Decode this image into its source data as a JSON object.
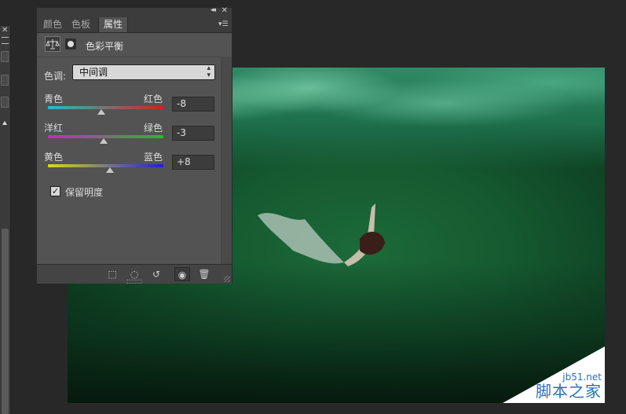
{
  "panel": {
    "tabs": [
      {
        "label": "颜色"
      },
      {
        "label": "色板"
      },
      {
        "label": "属性"
      }
    ],
    "title": "色彩平衡",
    "tone": {
      "label": "色调:",
      "selected": "中间调"
    },
    "sliders": [
      {
        "left": "青色",
        "right": "红色",
        "value": "-8",
        "level": -8,
        "colors": [
          "#19c4c4",
          "#d42020"
        ]
      },
      {
        "left": "洋红",
        "right": "绿色",
        "value": "-3",
        "level": -3,
        "colors": [
          "#d020c8",
          "#20c020"
        ]
      },
      {
        "left": "黄色",
        "right": "蓝色",
        "value": "+8",
        "level": 8,
        "colors": [
          "#d8d820",
          "#2020d8"
        ]
      }
    ],
    "preserve": {
      "label": "保留明度",
      "checked": true
    }
  },
  "watermark": {
    "url": "jb51.net",
    "brand": "脚本之家"
  },
  "icons": [
    "balance-icon",
    "mask-icon",
    "panel-menu-icon",
    "clip-to-layer-icon",
    "toggle-visibility-icon",
    "reset-icon",
    "eye-icon",
    "trash-icon"
  ]
}
